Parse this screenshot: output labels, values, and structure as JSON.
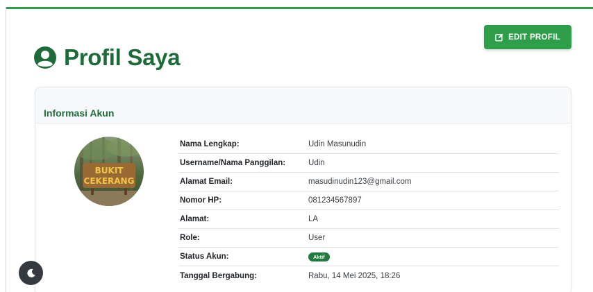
{
  "page": {
    "title": "Profil Saya",
    "edit_button_label": "EDIT PROFIL"
  },
  "card": {
    "header": "Informasi Akun"
  },
  "account": {
    "rows": [
      {
        "label": "Nama Lengkap:",
        "value": "Udin Masunudin"
      },
      {
        "label": "Username/Nama Panggilan:",
        "value": "Udin"
      },
      {
        "label": "Alamat Email:",
        "value": "masudinudin123@gmail.com"
      },
      {
        "label": "Nomor HP:",
        "value": "081234567897"
      },
      {
        "label": "Alamat:",
        "value": "LA"
      },
      {
        "label": "Role:",
        "value": "User"
      },
      {
        "label": "Status Akun:",
        "value": "Aktif"
      },
      {
        "label": "Tanggal Bergabung:",
        "value": "Rabu, 14 Mei 2025, 18:26"
      }
    ]
  },
  "avatar": {
    "sign_text_line1": "BUKIT",
    "sign_text_line2": "CEKERANG"
  },
  "icons": {
    "title_icon": "user-circle-icon",
    "edit_icon": "edit-icon",
    "theme_icon": "moon-icon"
  },
  "colors": {
    "primary_green": "#2e9e4b",
    "title_green": "#1e6b3a",
    "badge_green": "#1f7a3e",
    "toggle_dark": "#343a40"
  }
}
